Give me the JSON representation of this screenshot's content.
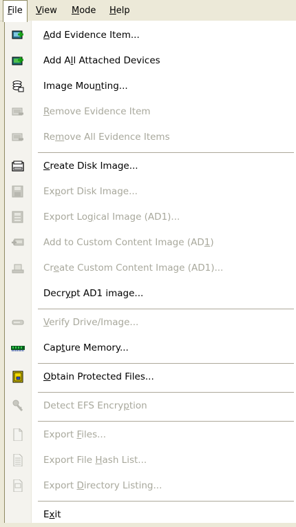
{
  "menubar": {
    "items": [
      {
        "label": "File",
        "access": "F",
        "rest": "ile",
        "open": true
      },
      {
        "label": "View",
        "access": "V",
        "rest": "iew",
        "open": false
      },
      {
        "label": "Mode",
        "access": "M",
        "rest": "ode",
        "open": false
      },
      {
        "label": "Help",
        "access": "H",
        "rest": "elp",
        "open": false
      }
    ]
  },
  "file_menu": {
    "items": [
      {
        "pre": "",
        "acc": "A",
        "post": "dd Evidence Item...",
        "enabled": true,
        "icon": "add-evidence-icon"
      },
      {
        "pre": "Add A",
        "acc": "l",
        "post": "l Attached Devices",
        "enabled": true,
        "icon": "add-all-devices-icon"
      },
      {
        "pre": "Image Mou",
        "acc": "n",
        "post": "ting...",
        "enabled": true,
        "icon": "image-mounting-icon"
      },
      {
        "pre": "",
        "acc": "R",
        "post": "emove Evidence Item",
        "enabled": false,
        "icon": "remove-evidence-icon"
      },
      {
        "pre": "Re",
        "acc": "m",
        "post": "ove All Evidence Items",
        "enabled": false,
        "icon": "remove-all-evidence-icon"
      },
      {
        "pre": "",
        "acc": "C",
        "post": "reate Disk Image...",
        "enabled": true,
        "icon": "create-disk-image-icon"
      },
      {
        "pre": "Ex",
        "acc": "p",
        "post": "ort Disk Image...",
        "enabled": false,
        "icon": "export-disk-image-icon"
      },
      {
        "pre": "Export Lo",
        "acc": "g",
        "post": "ical Image (AD1)...",
        "enabled": false,
        "icon": "export-logical-image-icon"
      },
      {
        "pre": "Add to Custom Content Image (AD",
        "acc": "1",
        "post": ")",
        "enabled": false,
        "icon": "add-custom-content-icon"
      },
      {
        "pre": "Cr",
        "acc": "e",
        "post": "ate Custom Content Image (AD1)...",
        "enabled": false,
        "icon": "create-custom-content-icon"
      },
      {
        "pre": "Decr",
        "acc": "y",
        "post": "pt AD1 image...",
        "enabled": true,
        "icon": ""
      },
      {
        "pre": "",
        "acc": "V",
        "post": "erify Drive/Image...",
        "enabled": false,
        "icon": "verify-drive-icon"
      },
      {
        "pre": "Cap",
        "acc": "t",
        "post": "ure Memory...",
        "enabled": true,
        "icon": "capture-memory-icon"
      },
      {
        "pre": "",
        "acc": "O",
        "post": "btain Protected Files...",
        "enabled": true,
        "icon": "obtain-protected-files-icon"
      },
      {
        "pre": "Detect EFS Encry",
        "acc": "p",
        "post": "tion",
        "enabled": false,
        "icon": "detect-efs-icon"
      },
      {
        "pre": "Export ",
        "acc": "F",
        "post": "iles...",
        "enabled": false,
        "icon": "export-files-icon"
      },
      {
        "pre": "Export File ",
        "acc": "H",
        "post": "ash List...",
        "enabled": false,
        "icon": "export-hash-list-icon"
      },
      {
        "pre": "Export ",
        "acc": "D",
        "post": "irectory Listing...",
        "enabled": false,
        "icon": "export-directory-listing-icon"
      },
      {
        "pre": "E",
        "acc": "x",
        "post": "it",
        "enabled": true,
        "icon": ""
      }
    ]
  },
  "colors": {
    "disabled_text": "#a8a89c",
    "separator": "#aca899",
    "menubar_bg": "#ece9d8"
  }
}
